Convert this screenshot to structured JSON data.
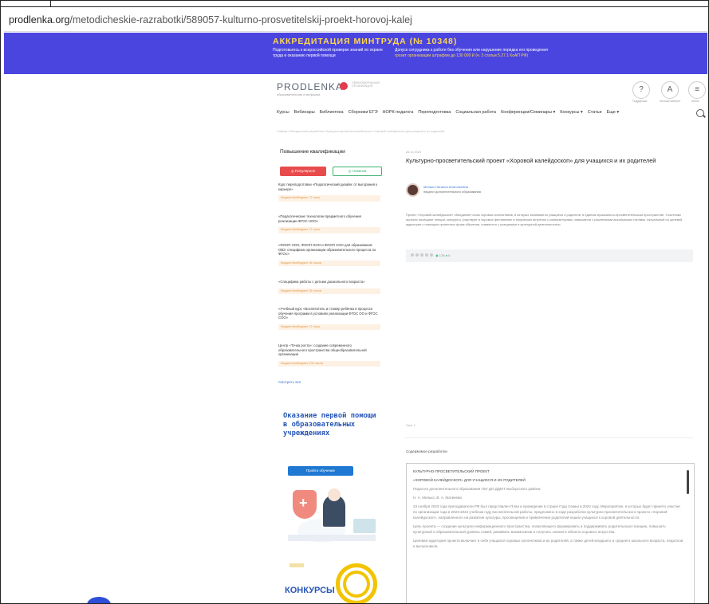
{
  "browser": {
    "url_domain": "prodlenka.org",
    "url_path": "/metodicheskie-razrabotki/589057-kulturno-prosvetitelskij-proekt-horovoj-kalej"
  },
  "banner": {
    "title": "АККРЕДИТАЦИЯ МИНТРУДА (№ 10348)",
    "col1": "Подготовьтесь к всероссийской проверке знаний по охране труда и оказанию первой помощи",
    "col2_main": "Допуск сотрудника к работе без обучения или нарушение порядка его проведения",
    "col2_warn": "грозит организации штрафом до 130 000 ₽ (ч. 3 статьи 5.27.1 КоАП РФ)"
  },
  "header": {
    "logo_text": "PRODLENKA",
    "logo_subtext": "образовательная платформа",
    "partner_text": "ОБРАЗОВАТЕЛЬНАЯ ОРГАНИЗАЦИЯ",
    "icons": [
      {
        "icon": "help-icon",
        "glyph": "?",
        "label": "Поддержка"
      },
      {
        "icon": "user-icon",
        "glyph": "A",
        "label": "Личный кабинет"
      },
      {
        "icon": "menu-icon",
        "glyph": "≡",
        "label": "Меню"
      }
    ]
  },
  "nav": {
    "items": [
      "Курсы",
      "Вебинары",
      "Библиотека",
      "Сборники ЕГЭ",
      "НОРК педагога",
      "Переподготовка",
      "Социальная работа",
      "Конференции/Семинары ▾",
      "Конкурсы ▾",
      "Статьи",
      "Еще ▾"
    ]
  },
  "breadcrumb": "Главная / Методические разработки / Культурно-просветительский проект «Хоровой калейдоскоп» для учащихся и их родителей",
  "sidebar": {
    "title": "Повышение квалификации",
    "btn_red": "◎ Популярное",
    "btn_green": "◎ Новинки",
    "courses": [
      {
        "title": "Курс переподготовки «Педагогический дизайн: от выгорания к карьере»",
        "price": "Бюджет/внебюджет 72 часа"
      },
      {
        "title": "«Педагогические технологии предметного обучения реализации ФГОС НОО»",
        "price": "Бюджет/внебюджет 72 часа"
      },
      {
        "title": "«ФООП НОО, ФООП ООО и ФООП СОО для образования: ОВЗ: специфика организации образовательного процесса по ФГОС»",
        "price": "Бюджет/внебюджет 36 часов"
      },
      {
        "title": "«Специфика работы с детьми дошкольного возраста»",
        "price": "Бюджет/внебюджет 36 часов"
      },
      {
        "title": "«Учебный курс «Воспитатель и стажёр ребёнка в процессе обучения программ в условиях реализации ФГОС ОО и ФГОС СОО»",
        "price": "Бюджет/внебюджет 72 часа"
      },
      {
        "title": "Центр «Точка роста»: создание современного образовательного пространства общеобразовательной организации",
        "price": "Бюджет/внебюджет 108 часов"
      }
    ],
    "more_link": "Смотреть все"
  },
  "article": {
    "date": "28.10.2023",
    "title": "Культурно-просветительский проект «Хоровой калейдоскоп» для учащихся и их родителей",
    "author_name": "Мелько Наталья Анатольевна",
    "author_role": "педагог дополнительного образования",
    "body": "Проект «Хоровой калейдоскоп» объединяет силы хоровых коллективов, в которых занимаются учащиеся и родители, в едином музыкально-просветительском пространстве. Участники проекта посещают лекции, концерты, участвуют в хоровых фестивалях и творческих встречах с композиторами, знакомятся с различными вокальными стилями. Актуальный по целевой аудитории с помощью проектных форм обучения, совместно с учащимися и культурной деятельностью.",
    "stats_likes": "178",
    "stats_comments": "0",
    "page_label": "Лист 1"
  },
  "document": {
    "section_label": "Содержимое разработки",
    "lines": [
      "КУЛЬТУРНО-ПРОСВЕТИТЕЛЬСКИЙ ПРОЕКТ",
      "«ХОРОВОЙ КАЛЕЙДОСКОП» ДЛЯ УЧАЩИХСЯ И ИХ РОДИТЕЛЕЙ",
      "Педагоги дополнительного образования ГБУ ДО ДДЮТ Выборгского района",
      "Н. А. Мелько, В. А. Матвеева",
      "23 ноября 2023 года преподаватели РФ был представлен План и проведение в стране Года Семьи в 2024 году. Мероприятие, в которых будет принято участие по организации года в 2023-2024 учебном году воспитательной работы, предложено в ходе разработки культурно-просветительского проекта «Хоровой калейдоскоп», направленного на развитие культуры, просвещения и привлечение родителей наших учащихся к хоровой деятельности.",
      "Цель проекта — создание культурно-информационного пространства, позволяющего формировать и поддерживать родительскую позицию, повышать культурный и образовательный уровень семей, развивать взаимосвязи и получать знания в области хорового искусства.",
      "Целевая аудитория проекта включает в себя учащихся хоровых коллективов и их родителей, а также детей младшего и среднего школьного возраста, педагогов и выпускников."
    ]
  },
  "promo": {
    "title": "Оказание первой помощи в образовательных учреждениях",
    "button": "Пройти обучение"
  },
  "contests": {
    "label": "КОНКУРСЫ"
  }
}
